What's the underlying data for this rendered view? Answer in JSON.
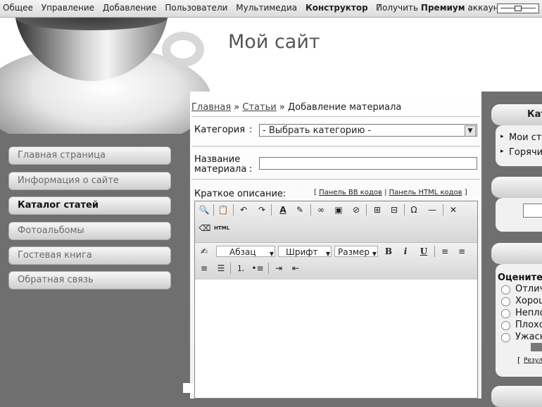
{
  "topbar": {
    "nav": [
      "Общее",
      "Управление",
      "Добавление",
      "Пользователи",
      "Мультимедиа",
      "Конструктор",
      "?"
    ],
    "premium_prefix": "Получить",
    "premium_bold": "Премиум",
    "premium_suffix": "аккаунт"
  },
  "site": {
    "title": "Мой сайт"
  },
  "menu": [
    {
      "label": "Главная страница"
    },
    {
      "label": "Информация о сайте"
    },
    {
      "label": "Каталог статей"
    },
    {
      "label": "Фотоальбомы"
    },
    {
      "label": "Гостевая книга"
    },
    {
      "label": "Обратная связь"
    }
  ],
  "breadcrumb": {
    "home": "Главная",
    "sep1": "»",
    "articles": "Статьи",
    "sep2": "»",
    "current": "Добавление материала"
  },
  "form": {
    "category_label": "Категория",
    "category_colon": ":",
    "category_value": "- Выбрать категорию -",
    "title_label_1": "Название",
    "title_label_2": "материала",
    "title_colon": ":",
    "short_label": "Краткое описание:",
    "panel_open": "[",
    "panel_bb": "Панель BB кодов",
    "panel_sep": "|",
    "panel_html": "Панель HTML кодов",
    "panel_close": "]"
  },
  "editor": {
    "paragraph": "Абзац",
    "font": "Шрифт",
    "size": "Размер",
    "html_label": "HTML"
  },
  "right": {
    "catalog_head": "Кат",
    "items": [
      "Мои ста",
      "Горячи"
    ],
    "rating_title": "Оцените м",
    "options": [
      "Отличн",
      "Хорош",
      "Неплох",
      "Плохо",
      "Ужасно"
    ],
    "results_open": "[",
    "results": "Резул"
  }
}
